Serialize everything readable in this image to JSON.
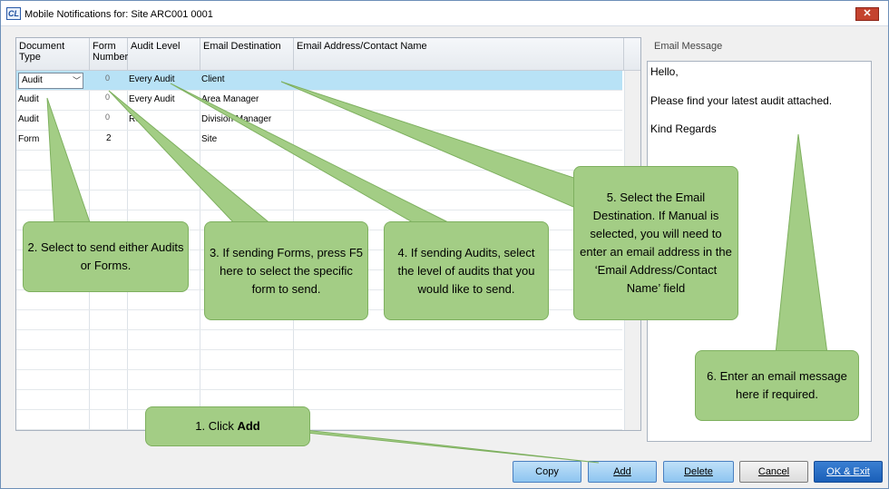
{
  "window": {
    "title": "Mobile Notifications for: Site ARC001     0001",
    "app_icon": "CL",
    "close_glyph": "✕"
  },
  "grid": {
    "headers": [
      "Document Type",
      "Form Number",
      "Audit Level",
      "Email Destination",
      "Email Address/Contact Name"
    ],
    "rows": [
      {
        "document_type": "Audit",
        "form_number": "0",
        "audit_level": "Every Audit",
        "email_destination": "Client",
        "email_address": "",
        "selected": true
      },
      {
        "document_type": "Audit",
        "form_number": "0",
        "audit_level": "Every Audit",
        "email_destination": "Area Manager",
        "email_address": ""
      },
      {
        "document_type": "Audit",
        "form_number": "0",
        "audit_level": "Re",
        "email_destination": "Division Manager",
        "email_address": ""
      },
      {
        "document_type": "Form",
        "form_number": "2",
        "audit_level": "",
        "email_destination": "Site",
        "email_address": ""
      }
    ]
  },
  "email_message": {
    "label": "Email Message",
    "lines": [
      "Hello,",
      "Please find your latest audit attached.",
      "Kind Regards"
    ]
  },
  "buttons": {
    "copy": "Copy",
    "add": "Add",
    "delete": "Delete",
    "cancel": "Cancel",
    "ok_exit": "OK & Exit"
  },
  "callouts": {
    "c1_prefix": "1. Click ",
    "c1_bold": "Add",
    "c2": "2. Select to send either Audits or Forms.",
    "c3": "3. If sending Forms, press F5 here to select the specific form to send.",
    "c4": "4. If sending Audits, select the level of audits that you would like to send.",
    "c5": "5. Select the Email Destination.  If Manual is selected, you will need to enter an email address in the ‘Email Address/Contact Name’ field",
    "c6": "6. Enter an email message here if required."
  },
  "colors": {
    "selected_row": "#b8e2f6",
    "callout_fill": "#a3cd85",
    "button_blue": "#8ec5f0",
    "close_red": "#c4432f"
  }
}
